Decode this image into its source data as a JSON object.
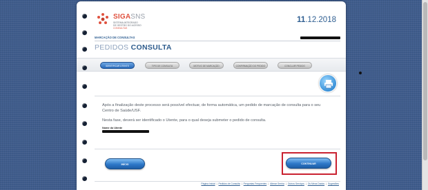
{
  "header": {
    "logo": {
      "name": "SIGA",
      "name_suffix": "SNS",
      "lines": [
        "SISTEMA INTEGRADO",
        "DE GESTÃO DO ACESSO",
        "CONSULTAS"
      ]
    },
    "date_day": "11",
    "date_rest": ".12.2018",
    "breadcrumb": "MARCAÇÃO DE CONSULTAS",
    "title_light": "PEDIDOS",
    "title_bold": "CONSULTA"
  },
  "steps": [
    {
      "label": "IDENTIFICAR UTENTE",
      "active": true
    },
    {
      "label": "TIPO DE CONSULTA",
      "active": false
    },
    {
      "label": "MOTIVO DE MARCAÇÃO",
      "active": false
    },
    {
      "label": "CONFIRMAÇÃO DO PEDIDO",
      "active": false
    },
    {
      "label": "CONCLUIR PEDIDO",
      "active": false
    }
  ],
  "body": {
    "paragraph1": "Após a finalização deste processo será possível efectuar, de forma automática, um pedido de marcação de consulta para o seu Centro de Saúde/USF.",
    "paragraph2": "Nesta fase, deverá ser identificado o Utente, para o qual deseja submeter o pedido de consulta.",
    "field_label": "Nome do Utente"
  },
  "buttons": {
    "inicio": "INÍCIO",
    "continuar": "CONTINUAR"
  },
  "footer": {
    "links": [
      "Página Inicial",
      "Pedidos de Consulta",
      "Perguntas Frequentes",
      "Alterar Senha",
      "Outros Serviços",
      "Os Meus Dados",
      "Sugestões"
    ]
  },
  "icons": {
    "print": "print-icon",
    "logo": "siga-logo-icon"
  },
  "colors": {
    "brand_red": "#e0523f",
    "brand_blue": "#2e5e91",
    "highlight": "#c9202f"
  }
}
